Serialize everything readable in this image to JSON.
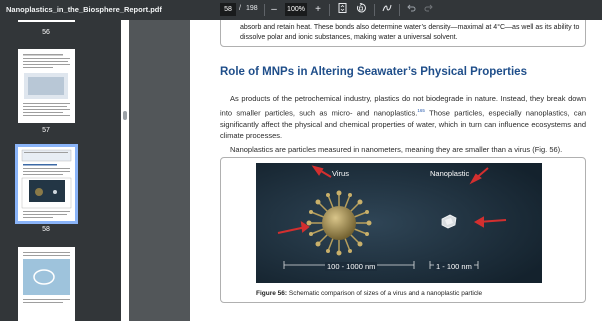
{
  "toolbar": {
    "doc_title": "Nanoplastics_in_the_Biosphere_Report.pdf",
    "current_page": "58",
    "page_separator": "/",
    "total_pages": "198",
    "zoom_minus": "–",
    "zoom": "100%",
    "zoom_plus": "+"
  },
  "sidebar": {
    "labels": [
      "56",
      "57",
      "58"
    ],
    "selected_page": "58"
  },
  "document": {
    "top_box_text": "absorb and retain heat. These bonds also determine water’s density—maximal at 4°C—as well as its ability to dissolve polar and ionic substances, making water a universal solvent.",
    "section_heading": "Role of MNPs in Altering Seawater’s Physical Properties",
    "paragraph1_a": "As products of the petrochemical industry, plastics do not biodegrade in nature. Instead, they break down into smaller particles, such as micro- and nanoplastics.",
    "paragraph1_ref": "165",
    "paragraph1_b": " Those particles, especially nanoplastics, can significantly affect the physical and chemical properties of water, which in turn can influence ecosystems and climate processes.",
    "paragraph2": "Nanoplastics are particles measured in nanometers, meaning they are smaller than a virus (Fig. 56).",
    "figure": {
      "label_virus": "Virus",
      "label_nanoplastic": "Nanoplastic",
      "scale_virus": "100 - 1000 nm",
      "scale_nano": "1 - 100 nm",
      "caption_bold": "Figure 56:",
      "caption_text": " Schematic comparison of sizes of a virus and a nanoplastic particle"
    }
  },
  "colors": {
    "accent": "#8ab4f8",
    "heading": "#1f4e8a",
    "arrow": "#d32f2f"
  }
}
